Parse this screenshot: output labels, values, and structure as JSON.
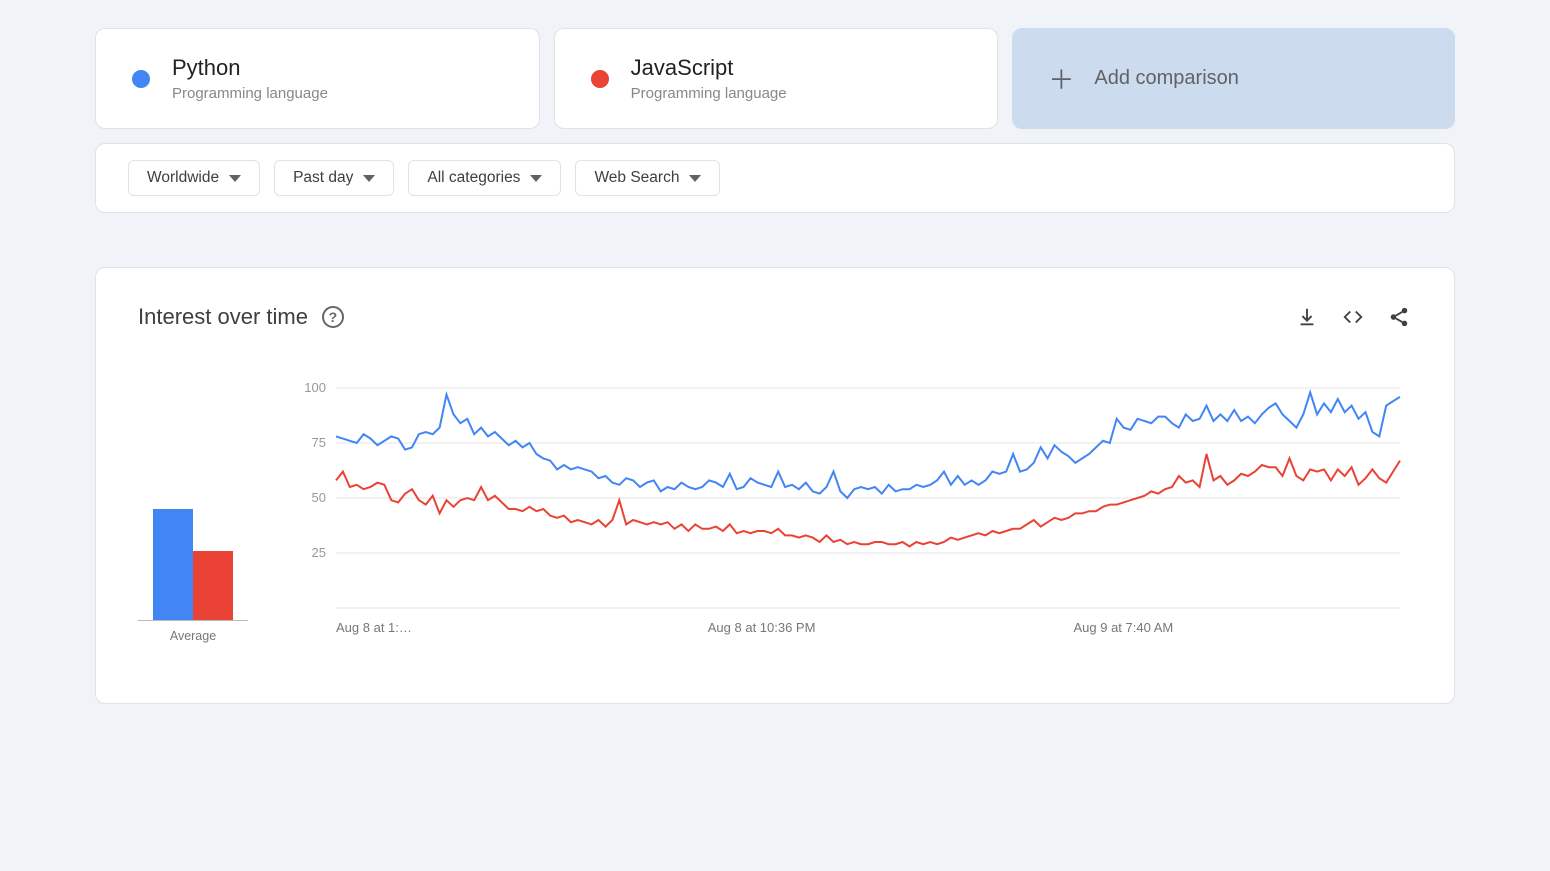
{
  "terms": [
    {
      "name": "Python",
      "subtitle": "Programming language",
      "color": "#4285f4"
    },
    {
      "name": "JavaScript",
      "subtitle": "Programming language",
      "color": "#ea4335"
    }
  ],
  "add_comparison_label": "Add comparison",
  "filters": {
    "region": "Worldwide",
    "time": "Past day",
    "category": "All categories",
    "type": "Web Search"
  },
  "panel": {
    "title": "Interest over time",
    "average_label": "Average"
  },
  "chart_data": {
    "type": "line",
    "ylabel": "",
    "ylim": [
      0,
      100
    ],
    "yticks": [
      25,
      50,
      75,
      100
    ],
    "x_tick_labels": [
      "Aug 8 at 1:…",
      "Aug 8 at 10:36 PM",
      "Aug 9 at 7:40 AM"
    ],
    "series": [
      {
        "name": "Python",
        "color": "#4285f4",
        "average": 72,
        "values": [
          78,
          77,
          76,
          75,
          79,
          77,
          74,
          76,
          78,
          77,
          72,
          73,
          79,
          80,
          79,
          82,
          97,
          88,
          84,
          86,
          79,
          82,
          78,
          80,
          77,
          74,
          76,
          73,
          75,
          70,
          68,
          67,
          63,
          65,
          63,
          64,
          63,
          62,
          59,
          60,
          57,
          56,
          59,
          58,
          55,
          57,
          58,
          53,
          55,
          54,
          57,
          55,
          54,
          55,
          58,
          57,
          55,
          61,
          54,
          55,
          59,
          57,
          56,
          55,
          62,
          55,
          56,
          54,
          57,
          53,
          52,
          55,
          62,
          53,
          50,
          54,
          55,
          54,
          55,
          52,
          56,
          53,
          54,
          54,
          56,
          55,
          56,
          58,
          62,
          56,
          60,
          56,
          58,
          56,
          58,
          62,
          61,
          62,
          70,
          62,
          63,
          66,
          73,
          68,
          74,
          71,
          69,
          66,
          68,
          70,
          73,
          76,
          75,
          86,
          82,
          81,
          86,
          85,
          84,
          87,
          87,
          84,
          82,
          88,
          85,
          86,
          92,
          85,
          88,
          85,
          90,
          85,
          87,
          84,
          88,
          91,
          93,
          88,
          85,
          82,
          88,
          98,
          88,
          93,
          89,
          95,
          89,
          92,
          86,
          89,
          80,
          78,
          92,
          94,
          96
        ]
      },
      {
        "name": "JavaScript",
        "color": "#ea4335",
        "average": 45,
        "values": [
          58,
          62,
          55,
          56,
          54,
          55,
          57,
          56,
          49,
          48,
          52,
          54,
          49,
          47,
          51,
          43,
          49,
          46,
          49,
          50,
          49,
          55,
          49,
          51,
          48,
          45,
          45,
          44,
          46,
          44,
          45,
          42,
          41,
          42,
          39,
          40,
          39,
          38,
          40,
          37,
          40,
          49,
          38,
          40,
          39,
          38,
          39,
          38,
          39,
          36,
          38,
          35,
          38,
          36,
          36,
          37,
          35,
          38,
          34,
          35,
          34,
          35,
          35,
          34,
          36,
          33,
          33,
          32,
          33,
          32,
          30,
          33,
          30,
          31,
          29,
          30,
          29,
          29,
          30,
          30,
          29,
          29,
          30,
          28,
          30,
          29,
          30,
          29,
          30,
          32,
          31,
          32,
          33,
          34,
          33,
          35,
          34,
          35,
          36,
          36,
          38,
          40,
          37,
          39,
          41,
          40,
          41,
          43,
          43,
          44,
          44,
          46,
          47,
          47,
          48,
          49,
          50,
          51,
          53,
          52,
          54,
          55,
          60,
          57,
          58,
          55,
          70,
          58,
          60,
          56,
          58,
          61,
          60,
          62,
          65,
          64,
          64,
          60,
          68,
          60,
          58,
          63,
          62,
          63,
          58,
          63,
          60,
          64,
          56,
          59,
          63,
          59,
          57,
          62,
          67
        ]
      }
    ]
  }
}
